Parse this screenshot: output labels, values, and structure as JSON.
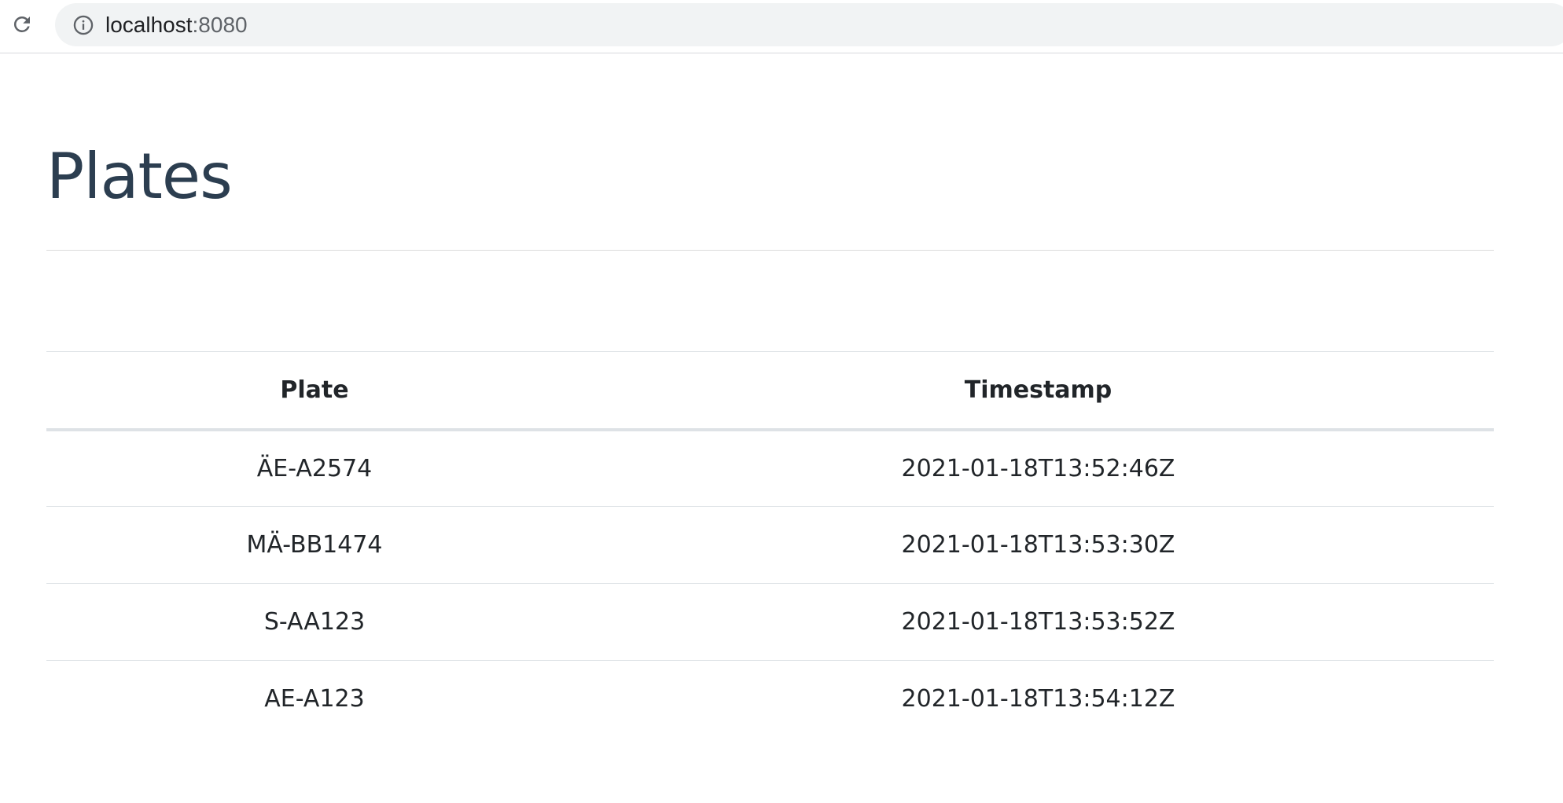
{
  "browser": {
    "url_host": "localhost",
    "url_port": ":8080"
  },
  "page": {
    "title": "Plates"
  },
  "table": {
    "headers": [
      "Plate",
      "Timestamp"
    ],
    "rows": [
      {
        "plate": "ÄE-A2574",
        "timestamp": "2021-01-18T13:52:46Z"
      },
      {
        "plate": "MÄ-BB1474",
        "timestamp": "2021-01-18T13:53:30Z"
      },
      {
        "plate": "S-AA123",
        "timestamp": "2021-01-18T13:53:52Z"
      },
      {
        "plate": "AE-A123",
        "timestamp": "2021-01-18T13:54:12Z"
      }
    ]
  },
  "colors": {
    "title": "#2c3e50",
    "text": "#212529",
    "address_bar_bg": "#f1f3f4"
  }
}
